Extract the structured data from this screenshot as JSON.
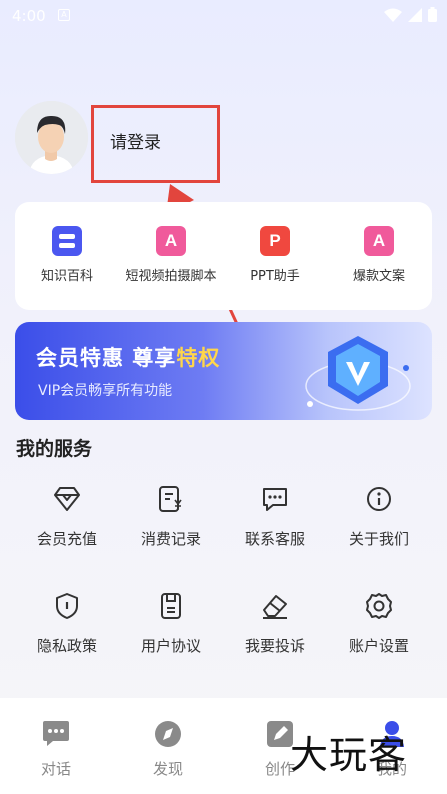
{
  "status_bar": {
    "time": "4:00"
  },
  "profile": {
    "login_text": "请登录"
  },
  "tools": [
    {
      "label": "知识百科",
      "icon": "encyclopedia-icon",
      "glyph": "",
      "color": "#4b57f0"
    },
    {
      "label": "短视频拍摄脚本",
      "icon": "script-icon",
      "glyph": "A",
      "color": "#f05a9b"
    },
    {
      "label": "PPT助手",
      "icon": "ppt-icon",
      "glyph": "P",
      "color": "#f0483f"
    },
    {
      "label": "爆款文案",
      "icon": "copywriting-icon",
      "glyph": "A",
      "color": "#f05a9b"
    }
  ],
  "vip": {
    "title_main": "会员特惠 尊享",
    "title_highlight": "特权",
    "subtitle": "VIP会员畅享所有功能"
  },
  "services_title": "我的服务",
  "services": [
    {
      "label": "会员充值",
      "icon": "diamond-icon"
    },
    {
      "label": "消费记录",
      "icon": "receipt-icon"
    },
    {
      "label": "联系客服",
      "icon": "chat-icon"
    },
    {
      "label": "关于我们",
      "icon": "info-icon"
    },
    {
      "label": "隐私政策",
      "icon": "shield-icon"
    },
    {
      "label": "用户协议",
      "icon": "document-icon"
    },
    {
      "label": "我要投诉",
      "icon": "eraser-icon"
    },
    {
      "label": "账户设置",
      "icon": "gear-icon"
    }
  ],
  "tabs": [
    {
      "label": "对话",
      "icon": "chat-bubble-icon"
    },
    {
      "label": "发现",
      "icon": "compass-icon"
    },
    {
      "label": "创作",
      "icon": "pen-icon"
    },
    {
      "label": "我的",
      "icon": "user-icon"
    }
  ],
  "watermark": "大玩客",
  "colors": {
    "annotation": "#e2453d",
    "accent": "#3b4ee9",
    "highlight": "#ffd64a"
  }
}
